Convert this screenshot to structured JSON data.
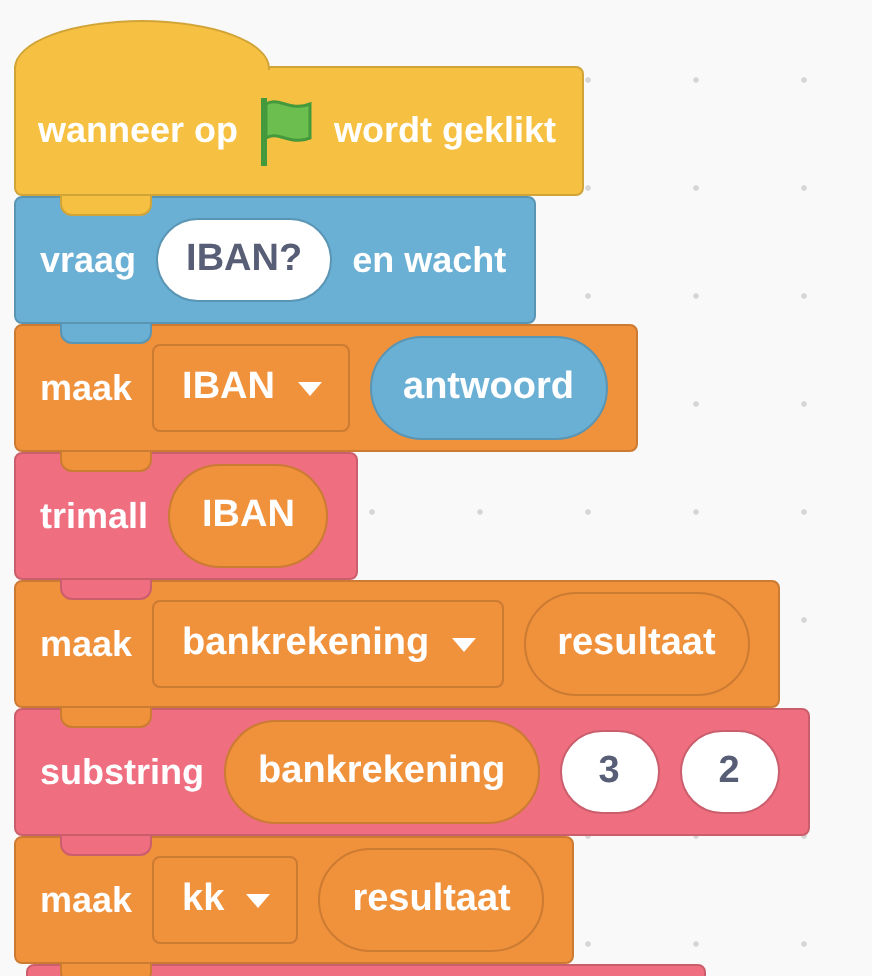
{
  "blocks": [
    {
      "kind": "hat",
      "color": "#f6c142",
      "parts": [
        {
          "kind": "label",
          "text": "wanneer op"
        },
        {
          "kind": "flag"
        },
        {
          "kind": "label",
          "text": "wordt geklikt"
        }
      ]
    },
    {
      "kind": "stack",
      "color": "#6aafd4",
      "parts": [
        {
          "kind": "label",
          "text": "vraag"
        },
        {
          "kind": "text_input",
          "text": "IBAN?"
        },
        {
          "kind": "label",
          "text": "en wacht"
        }
      ]
    },
    {
      "kind": "stack",
      "color": "#f0913c",
      "parts": [
        {
          "kind": "label",
          "text": "maak"
        },
        {
          "kind": "dropdown",
          "text": "IBAN"
        },
        {
          "kind": "reporter",
          "text": "antwoord",
          "color": "#6aafd4"
        }
      ]
    },
    {
      "kind": "stack",
      "color": "#ef6e80",
      "parts": [
        {
          "kind": "label",
          "text": "trimall"
        },
        {
          "kind": "reporter",
          "text": "IBAN",
          "color": "#f0913c"
        }
      ]
    },
    {
      "kind": "stack",
      "color": "#f0913c",
      "parts": [
        {
          "kind": "label",
          "text": "maak"
        },
        {
          "kind": "dropdown",
          "text": "bankrekening"
        },
        {
          "kind": "reporter",
          "text": "resultaat",
          "color": "#f0913c"
        }
      ]
    },
    {
      "kind": "stack",
      "color": "#ef6e80",
      "parts": [
        {
          "kind": "label",
          "text": "substring"
        },
        {
          "kind": "reporter",
          "text": "bankrekening",
          "color": "#f0913c"
        },
        {
          "kind": "text_input",
          "text": "3"
        },
        {
          "kind": "text_input",
          "text": "2"
        }
      ]
    },
    {
      "kind": "stack",
      "color": "#f0913c",
      "parts": [
        {
          "kind": "label",
          "text": "maak"
        },
        {
          "kind": "dropdown",
          "text": "kk"
        },
        {
          "kind": "reporter",
          "text": "resultaat",
          "color": "#f0913c"
        }
      ]
    },
    {
      "kind": "stack",
      "color": "#ef6e80"
    }
  ]
}
